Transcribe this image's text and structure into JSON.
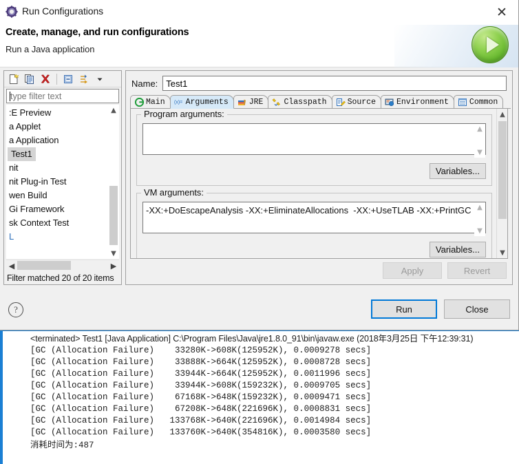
{
  "window": {
    "title": "Run Configurations",
    "icon": "eclipse-run-config-icon",
    "close_label": "✕"
  },
  "header": {
    "title": "Create, manage, and run configurations",
    "subtitle": "Run a Java application",
    "badge_icon": "green-run-play-icon"
  },
  "left_panel": {
    "toolbar": [
      {
        "name": "new-configuration-icon",
        "tooltip": "New launch configuration"
      },
      {
        "name": "duplicate-configuration-icon",
        "tooltip": "Duplicate"
      },
      {
        "name": "delete-configuration-icon",
        "tooltip": "Delete"
      },
      {
        "name": "collapse-all-icon",
        "tooltip": "Collapse All"
      },
      {
        "name": "filter-icon",
        "tooltip": "Filter launch configurations"
      },
      {
        "name": "view-menu-chevron-icon",
        "tooltip": "View Menu"
      }
    ],
    "filter": {
      "value": "",
      "placeholder": "type filter text"
    },
    "items": [
      {
        "label": ":E Preview",
        "selected": false,
        "blue": false
      },
      {
        "label": "a Applet",
        "selected": false,
        "blue": false
      },
      {
        "label": "a Application",
        "selected": false,
        "blue": false
      },
      {
        "label": "Test1",
        "selected": true,
        "blue": false
      },
      {
        "label": "nit",
        "selected": false,
        "blue": false
      },
      {
        "label": "nit Plug-in Test",
        "selected": false,
        "blue": false
      },
      {
        "label": "wen Build",
        "selected": false,
        "blue": false
      },
      {
        "label": "Gi Framework",
        "selected": false,
        "blue": false
      },
      {
        "label": "sk Context Test",
        "selected": false,
        "blue": false
      },
      {
        "label": "L",
        "selected": false,
        "blue": true
      }
    ],
    "status": "Filter matched 20 of 20 items",
    "scroll_up_icon": "chevron-up-icon",
    "scroll_down_icon": "chevron-down-icon",
    "scroll_left_icon": "chevron-left-icon",
    "scroll_right_icon": "chevron-right-icon"
  },
  "right_panel": {
    "name_label": "Name:",
    "name_value": "Test1",
    "tabs": [
      {
        "label": "Main",
        "icon": "main-tab-icon",
        "active": false
      },
      {
        "label": "Arguments",
        "icon": "arguments-tab-icon",
        "active": true
      },
      {
        "label": "JRE",
        "icon": "jre-tab-icon",
        "active": false
      },
      {
        "label": "Classpath",
        "icon": "classpath-tab-icon",
        "active": false
      },
      {
        "label": "Source",
        "icon": "source-tab-icon",
        "active": false
      },
      {
        "label": "Environment",
        "icon": "environment-tab-icon",
        "active": false
      },
      {
        "label": "Common",
        "icon": "common-tab-icon",
        "active": false
      }
    ],
    "program_arguments": {
      "legend": "Program arguments:",
      "value": "",
      "variables_button": "Variables..."
    },
    "vm_arguments": {
      "legend": "VM arguments:",
      "value": "-XX:+DoEscapeAnalysis -XX:+EliminateAllocations  -XX:+UseTLAB -XX:+PrintGC",
      "variables_button": "Variables..."
    },
    "apply_button": "Apply",
    "revert_button": "Revert"
  },
  "footer": {
    "help_label": "?",
    "run_button": "Run",
    "close_button": "Close"
  },
  "console": {
    "header": "<terminated> Test1 [Java Application] C:\\Program Files\\Java\\jre1.8.0_91\\bin\\javaw.exe (2018年3月25日 下午12:39:31)",
    "lines": [
      "[GC (Allocation Failure)    33280K->608K(125952K), 0.0009278 secs]",
      "[GC (Allocation Failure)    33888K->664K(125952K), 0.0008728 secs]",
      "[GC (Allocation Failure)    33944K->664K(125952K), 0.0011996 secs]",
      "[GC (Allocation Failure)    33944K->608K(159232K), 0.0009705 secs]",
      "[GC (Allocation Failure)    67168K->648K(159232K), 0.0009471 secs]",
      "[GC (Allocation Failure)    67208K->648K(221696K), 0.0008831 secs]",
      "[GC (Allocation Failure)   133768K->640K(221696K), 0.0014984 secs]",
      "[GC (Allocation Failure)   133760K->640K(354816K), 0.0003580 secs]"
    ],
    "final_line_cjk": "消耗时间为",
    "final_line_value": ":487"
  },
  "colors": {
    "accent_blue": "#0078d7",
    "console_border": "#1a7fd4",
    "tab_active": "#d6e9f8",
    "selection_gray": "#d4d4d4",
    "run_green": "#63b52c",
    "delete_red": "#cc2222"
  }
}
